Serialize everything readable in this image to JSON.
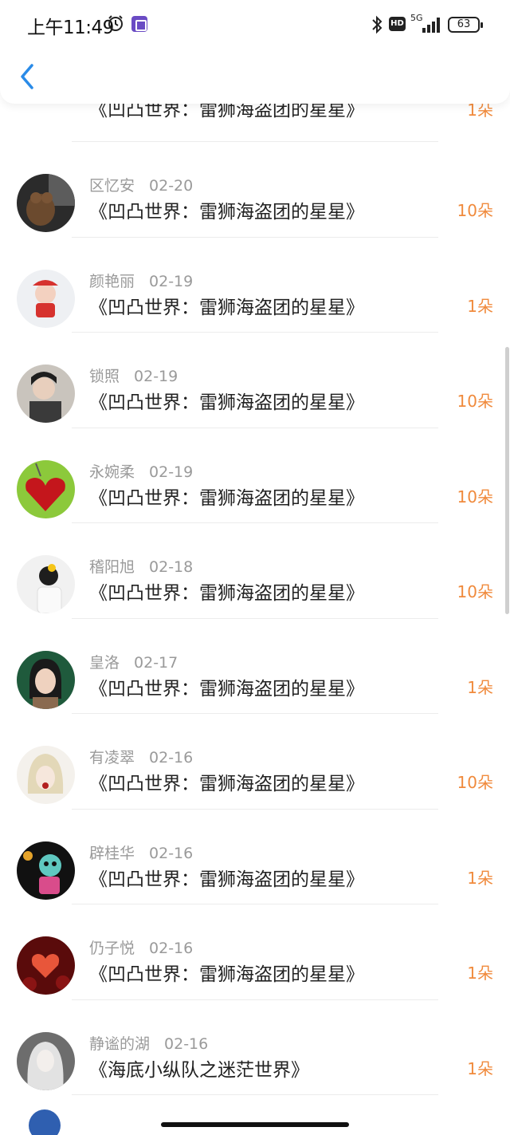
{
  "status_bar": {
    "time": "上午11:49",
    "network": "5G",
    "hd": "HD",
    "battery": "63"
  },
  "nav": {
    "back_icon": "chevron-left-icon"
  },
  "colors": {
    "accent": "#2a8be8",
    "count": "#f08a3c"
  },
  "list": {
    "partial_top": {
      "book": "《凹凸世界：雷狮海盗团的星星》",
      "count": "1朵"
    },
    "items": [
      {
        "name": "区忆安",
        "date": "02-20",
        "book": "《凹凸世界：雷狮海盗团的星星》",
        "count": "10朵"
      },
      {
        "name": "颜艳丽",
        "date": "02-19",
        "book": "《凹凸世界：雷狮海盗团的星星》",
        "count": "1朵"
      },
      {
        "name": "锁照",
        "date": "02-19",
        "book": "《凹凸世界：雷狮海盗团的星星》",
        "count": "10朵"
      },
      {
        "name": "永婉柔",
        "date": "02-19",
        "book": "《凹凸世界：雷狮海盗团的星星》",
        "count": "10朵"
      },
      {
        "name": "稽阳旭",
        "date": "02-18",
        "book": "《凹凸世界：雷狮海盗团的星星》",
        "count": "10朵"
      },
      {
        "name": "皇洛",
        "date": "02-17",
        "book": "《凹凸世界：雷狮海盗团的星星》",
        "count": "1朵"
      },
      {
        "name": "有凌翠",
        "date": "02-16",
        "book": "《凹凸世界：雷狮海盗团的星星》",
        "count": "10朵"
      },
      {
        "name": "辟桂华",
        "date": "02-16",
        "book": "《凹凸世界：雷狮海盗团的星星》",
        "count": "1朵"
      },
      {
        "name": "仍子悦",
        "date": "02-16",
        "book": "《凹凸世界：雷狮海盗团的星星》",
        "count": "1朵"
      },
      {
        "name": "静谧的湖",
        "date": "02-16",
        "book": "《海底小纵队之迷茫世界》",
        "count": "1朵"
      }
    ]
  }
}
